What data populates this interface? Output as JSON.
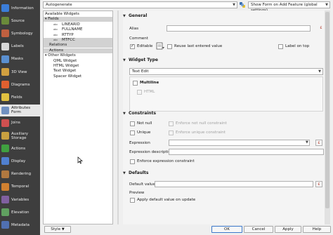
{
  "nav": {
    "items": [
      {
        "label": "Information",
        "icon": "info-icon",
        "color": "#3b7dd8"
      },
      {
        "label": "Source",
        "icon": "source-icon",
        "color": "#6a8a3a"
      },
      {
        "label": "Symbology",
        "icon": "symbology-icon",
        "color": "#c06040"
      },
      {
        "label": "Labels",
        "icon": "labels-icon",
        "color": "#d8d8d8"
      },
      {
        "label": "Masks",
        "icon": "masks-icon",
        "color": "#5a8fd0"
      },
      {
        "label": "3D View",
        "icon": "cube-icon",
        "color": "#d0a040"
      },
      {
        "label": "Diagrams",
        "icon": "diagrams-icon",
        "color": "#e06030"
      },
      {
        "label": "Fields",
        "icon": "fields-icon",
        "color": "#e0c040"
      },
      {
        "label": "Attributes Form",
        "icon": "form-icon",
        "color": "#7090c0"
      },
      {
        "label": "Joins",
        "icon": "joins-icon",
        "color": "#d05050"
      },
      {
        "label": "Auxiliary Storage",
        "icon": "storage-icon",
        "color": "#c9a040"
      },
      {
        "label": "Actions",
        "icon": "actions-icon",
        "color": "#40a040"
      },
      {
        "label": "Display",
        "icon": "display-icon",
        "color": "#5080d0"
      },
      {
        "label": "Rendering",
        "icon": "brush-icon",
        "color": "#b07840"
      },
      {
        "label": "Temporal",
        "icon": "clock-icon",
        "color": "#d08030"
      },
      {
        "label": "Variables",
        "icon": "variables-icon",
        "color": "#8060a0"
      },
      {
        "label": "Elevation",
        "icon": "elevation-icon",
        "color": "#60a060"
      },
      {
        "label": "Metadata",
        "icon": "metadata-icon",
        "color": "#5070b0"
      }
    ],
    "active_index": 8
  },
  "topbar": {
    "layout_mode": "Autogenerate",
    "python_icon": "python-icon",
    "show_form_option": "Show Form on Add Feature (global settings)"
  },
  "tree": {
    "rows": [
      {
        "label": "Available Widgets",
        "level": 0,
        "selected": false,
        "abc": false
      },
      {
        "label": "Fields",
        "level": 0,
        "selected": true,
        "abc": false,
        "expander": "▾"
      },
      {
        "label": "LINEARID",
        "level": 2,
        "selected": false,
        "abc": true
      },
      {
        "label": "FULLNAME",
        "level": 2,
        "selected": false,
        "abc": true
      },
      {
        "label": "RTTYP",
        "level": 2,
        "selected": false,
        "abc": true
      },
      {
        "label": "MTFCC",
        "level": 2,
        "selected": true,
        "abc": true
      },
      {
        "label": "Relations",
        "level": 1,
        "selected": true,
        "abc": false
      },
      {
        "label": "Actions",
        "level": 1,
        "selected": true,
        "abc": false
      },
      {
        "label": "Other Widgets",
        "level": 0,
        "selected": false,
        "abc": false,
        "expander": "▾"
      },
      {
        "label": "QML Widget",
        "level": 2,
        "selected": false,
        "abc": false
      },
      {
        "label": "HTML Widget",
        "level": 2,
        "selected": false,
        "abc": false
      },
      {
        "label": "Text Widget",
        "level": 2,
        "selected": false,
        "abc": false
      },
      {
        "label": "Spacer Widget",
        "level": 2,
        "selected": false,
        "abc": false
      }
    ]
  },
  "general": {
    "title": "General",
    "alias_label": "Alias",
    "comment_label": "Comment",
    "editable_label": "Editable",
    "reuse_label": "Reuse last entered value",
    "label_on_top_label": "Label on top"
  },
  "widget_type": {
    "title": "Widget Type",
    "selected": "Text Edit",
    "multiline_label": "Multiline",
    "html_label": "HTML"
  },
  "constraints": {
    "title": "Constraints",
    "not_null_label": "Not null",
    "enforce_not_null_label": "Enforce not null constraint",
    "unique_label": "Unique",
    "enforce_unique_label": "Enforce unique constraint",
    "expression_label": "Expression",
    "expression_desc_label": "Expression description",
    "enforce_expression_label": "Enforce expression constraint"
  },
  "defaults": {
    "title": "Defaults",
    "default_value_label": "Default value",
    "preview_label": "Preview",
    "apply_on_update_label": "Apply default value on update"
  },
  "buttons": {
    "style": "Style",
    "ok": "OK",
    "cancel": "Cancel",
    "apply": "Apply",
    "help": "Help"
  }
}
